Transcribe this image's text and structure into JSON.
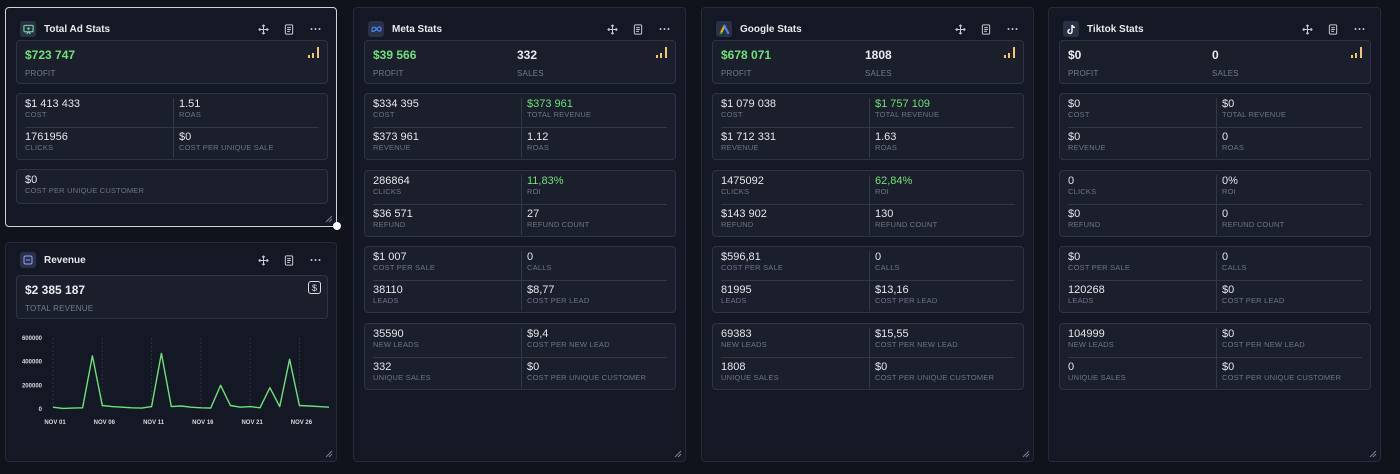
{
  "total": {
    "title": "Total Ad Stats",
    "profit": "$723 747",
    "profit_label": "PROFIT",
    "cost": "$1 413 433",
    "cost_label": "COST",
    "roas": "1.51",
    "roas_label": "ROAS",
    "clicks": "1761956",
    "clicks_label": "CLICKS",
    "cpus": "$0",
    "cpus_label": "COST PER UNIQUE SALE",
    "cpuc": "$0",
    "cpuc_label": "COST PER UNIQUE CUSTOMER"
  },
  "revenue": {
    "title": "Revenue",
    "total": "$2 385 187",
    "total_label": "TOTAL REVENUE"
  },
  "chart_data": {
    "type": "line",
    "yticks": [
      "600000",
      "400000",
      "200000",
      "0"
    ],
    "xticks": [
      "NOV 01",
      "NOV 06",
      "NOV 11",
      "NOV 16",
      "NOV 21",
      "NOV 26"
    ],
    "ylim": [
      0,
      600000
    ],
    "x": [
      1,
      2,
      3,
      4,
      5,
      6,
      7,
      8,
      9,
      10,
      11,
      12,
      13,
      14,
      15,
      16,
      17,
      18,
      19,
      20,
      21,
      22,
      23,
      24,
      25,
      26,
      27,
      28,
      29
    ],
    "values": [
      15000,
      5000,
      8000,
      10000,
      450000,
      30000,
      20000,
      15000,
      10000,
      8000,
      20000,
      470000,
      20000,
      25000,
      15000,
      10000,
      8000,
      200000,
      30000,
      15000,
      20000,
      10000,
      180000,
      20000,
      420000,
      30000,
      25000,
      20000,
      15000
    ],
    "line_color": "#6fe07a",
    "grid": "vertical dashed"
  },
  "colors": {
    "green": "#6fe07a",
    "bars": "#f2c66b"
  },
  "platforms": [
    {
      "title": "Meta Stats",
      "logo": "meta-logo",
      "top": [
        {
          "v": "$39 566",
          "l": "PROFIT",
          "green": true
        },
        {
          "v": "332",
          "l": "SALES",
          "green": false
        }
      ],
      "groups": [
        [
          {
            "v": "$334 395",
            "l": "COST"
          },
          {
            "v": "$373 961",
            "l": "TOTAL REVENUE",
            "green": true
          },
          {
            "v": "$373 961",
            "l": "REVENUE"
          },
          {
            "v": "1.12",
            "l": "ROAS"
          }
        ],
        [
          {
            "v": "286864",
            "l": "CLICKS"
          },
          {
            "v": "11,83%",
            "l": "ROI",
            "green": true
          },
          {
            "v": "$36 571",
            "l": "REFUND"
          },
          {
            "v": "27",
            "l": "REFUND COUNT"
          }
        ],
        [
          {
            "v": "$1 007",
            "l": "COST PER SALE"
          },
          {
            "v": "0",
            "l": "CALLS"
          },
          {
            "v": "38110",
            "l": "LEADS"
          },
          {
            "v": "$8,77",
            "l": "COST PER LEAD"
          }
        ],
        [
          {
            "v": "35590",
            "l": "NEW LEADS"
          },
          {
            "v": "$9,4",
            "l": "COST PER NEW LEAD"
          },
          {
            "v": "332",
            "l": "UNIQUE SALES"
          },
          {
            "v": "$0",
            "l": "COST PER UNIQUE CUSTOMER"
          }
        ]
      ]
    },
    {
      "title": "Google Stats",
      "logo": "google-ads-logo",
      "top": [
        {
          "v": "$678 071",
          "l": "PROFIT",
          "green": true
        },
        {
          "v": "1808",
          "l": "SALES",
          "green": false
        }
      ],
      "groups": [
        [
          {
            "v": "$1 079 038",
            "l": "COST"
          },
          {
            "v": "$1 757 109",
            "l": "TOTAL REVENUE",
            "green": true
          },
          {
            "v": "$1 712 331",
            "l": "REVENUE"
          },
          {
            "v": "1.63",
            "l": "ROAS"
          }
        ],
        [
          {
            "v": "1475092",
            "l": "CLICKS"
          },
          {
            "v": "62,84%",
            "l": "ROI",
            "green": true
          },
          {
            "v": "$143 902",
            "l": "REFUND"
          },
          {
            "v": "130",
            "l": "REFUND COUNT"
          }
        ],
        [
          {
            "v": "$596,81",
            "l": "COST PER SALE"
          },
          {
            "v": "0",
            "l": "CALLS"
          },
          {
            "v": "81995",
            "l": "LEADS"
          },
          {
            "v": "$13,16",
            "l": "COST PER LEAD"
          }
        ],
        [
          {
            "v": "69383",
            "l": "NEW LEADS"
          },
          {
            "v": "$15,55",
            "l": "COST PER NEW LEAD"
          },
          {
            "v": "1808",
            "l": "UNIQUE SALES"
          },
          {
            "v": "$0",
            "l": "COST PER UNIQUE CUSTOMER"
          }
        ]
      ]
    },
    {
      "title": "Tiktok Stats",
      "logo": "tiktok-logo",
      "top": [
        {
          "v": "$0",
          "l": "PROFIT",
          "green": false
        },
        {
          "v": "0",
          "l": "SALES",
          "green": false
        }
      ],
      "groups": [
        [
          {
            "v": "$0",
            "l": "COST"
          },
          {
            "v": "$0",
            "l": "TOTAL REVENUE"
          },
          {
            "v": "$0",
            "l": "REVENUE"
          },
          {
            "v": "0",
            "l": "ROAS"
          }
        ],
        [
          {
            "v": "0",
            "l": "CLICKS"
          },
          {
            "v": "0%",
            "l": "ROI"
          },
          {
            "v": "$0",
            "l": "REFUND"
          },
          {
            "v": "0",
            "l": "REFUND COUNT"
          }
        ],
        [
          {
            "v": "$0",
            "l": "COST PER SALE"
          },
          {
            "v": "0",
            "l": "CALLS"
          },
          {
            "v": "120268",
            "l": "LEADS"
          },
          {
            "v": "$0",
            "l": "COST PER LEAD"
          }
        ],
        [
          {
            "v": "104999",
            "l": "NEW LEADS"
          },
          {
            "v": "$0",
            "l": "COST PER NEW LEAD"
          },
          {
            "v": "0",
            "l": "UNIQUE SALES"
          },
          {
            "v": "$0",
            "l": "COST PER UNIQUE CUSTOMER"
          }
        ]
      ]
    }
  ]
}
